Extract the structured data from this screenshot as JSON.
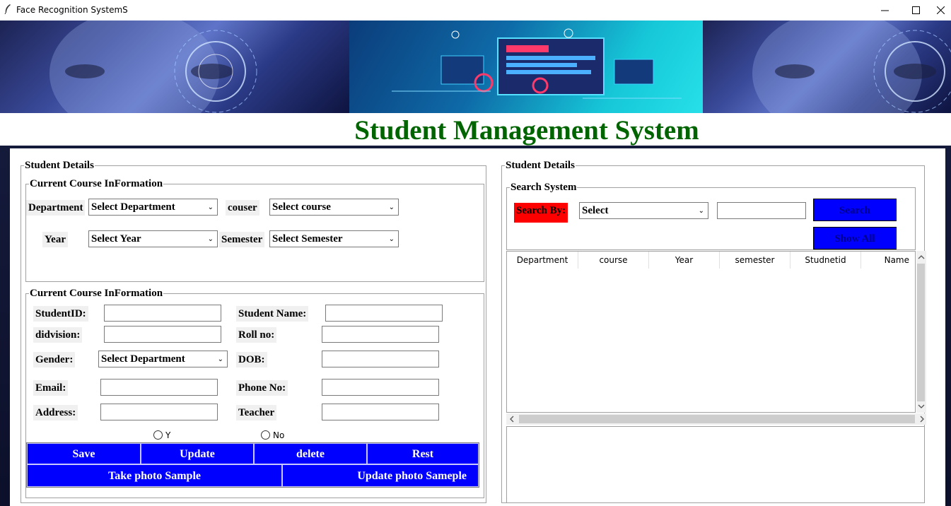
{
  "window": {
    "title": "Face Recognition SystemS",
    "minimize": "—",
    "maximize": "☐",
    "close": "✕"
  },
  "header": {
    "title": "Student Management System",
    "title_color": "#006400"
  },
  "left": {
    "frame_title": "Student Details",
    "course_section": {
      "title": "Current Course InFormation",
      "department_label": "Department",
      "department_value": "Select Department",
      "course_label": "couser",
      "course_value": "Select course",
      "year_label": "Year",
      "year_value": "Select Year",
      "semester_label": "Semester",
      "semester_value": "Select Semester"
    },
    "student_section": {
      "title": "Current Course InFormation",
      "student_id_label": "StudentID:",
      "student_name_label": "Student Name:",
      "division_label": "didvision:",
      "roll_label": "Roll no:",
      "gender_label": "Gender:",
      "gender_value": "Select Department",
      "dob_label": "DOB:",
      "email_label": "Email:",
      "phone_label": "Phone No:",
      "address_label": "Address:",
      "teacher_label": "Teacher",
      "radio_yes": "Y",
      "radio_no": "No"
    },
    "buttons": {
      "save": "Save",
      "update": "Update",
      "delete": "delete",
      "reset": "Rest",
      "take_photo": "Take photo Sample",
      "update_photo": "Update photo Sameple"
    }
  },
  "right": {
    "frame_title": "Student Details",
    "search": {
      "title": "Search System",
      "search_by_label": "Search By:",
      "search_by_value": "Select",
      "search_button": "Search",
      "show_all_button": "Show All"
    },
    "table": {
      "columns": [
        "Department",
        "course",
        "Year",
        "semester",
        "Studnetid",
        "Name"
      ]
    }
  },
  "colors": {
    "accent_blue": "#0000ff",
    "label_red": "#ff0000"
  }
}
